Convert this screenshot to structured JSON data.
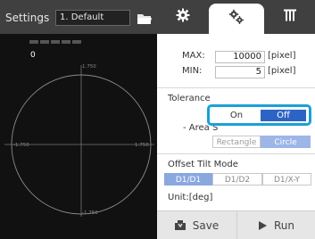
{
  "header": {
    "settings_label": "Settings",
    "preset_value": "1. Default",
    "icons": [
      "folder-icon",
      "gear-icon",
      "gears-icon",
      "tilt-icon"
    ]
  },
  "viewer": {
    "count": "0",
    "axis_top": "1.750",
    "axis_bottom": "-1.750",
    "axis_left": "-1.750",
    "axis_right": "1.750"
  },
  "measure": {
    "max_label": "MAX:",
    "max_value": "10000",
    "max_unit": "[pixel]",
    "min_label": "MIN:",
    "min_value": "5",
    "min_unit": "[pixel]"
  },
  "tolerance": {
    "title": "Tolerance",
    "on_label": "On",
    "off_label": "Off",
    "selected": "Off",
    "area_label": "- Area S",
    "shape_options": [
      "Rectangle",
      "Circle"
    ],
    "shape_selected": "Circle"
  },
  "offset": {
    "title": "Offset Tilt Mode",
    "options": [
      "D1/D1",
      "D1/D2",
      "D1/X-Y"
    ],
    "selected": "D1/D1",
    "unit": "Unit:[deg]"
  },
  "footer": {
    "save_label": "Save",
    "run_label": "Run"
  },
  "colors": {
    "topbar": "#404040",
    "accent_outline": "#1aa0d8",
    "selected_blue": "#2c64c4",
    "inactive_blue": "#9db6e8"
  }
}
